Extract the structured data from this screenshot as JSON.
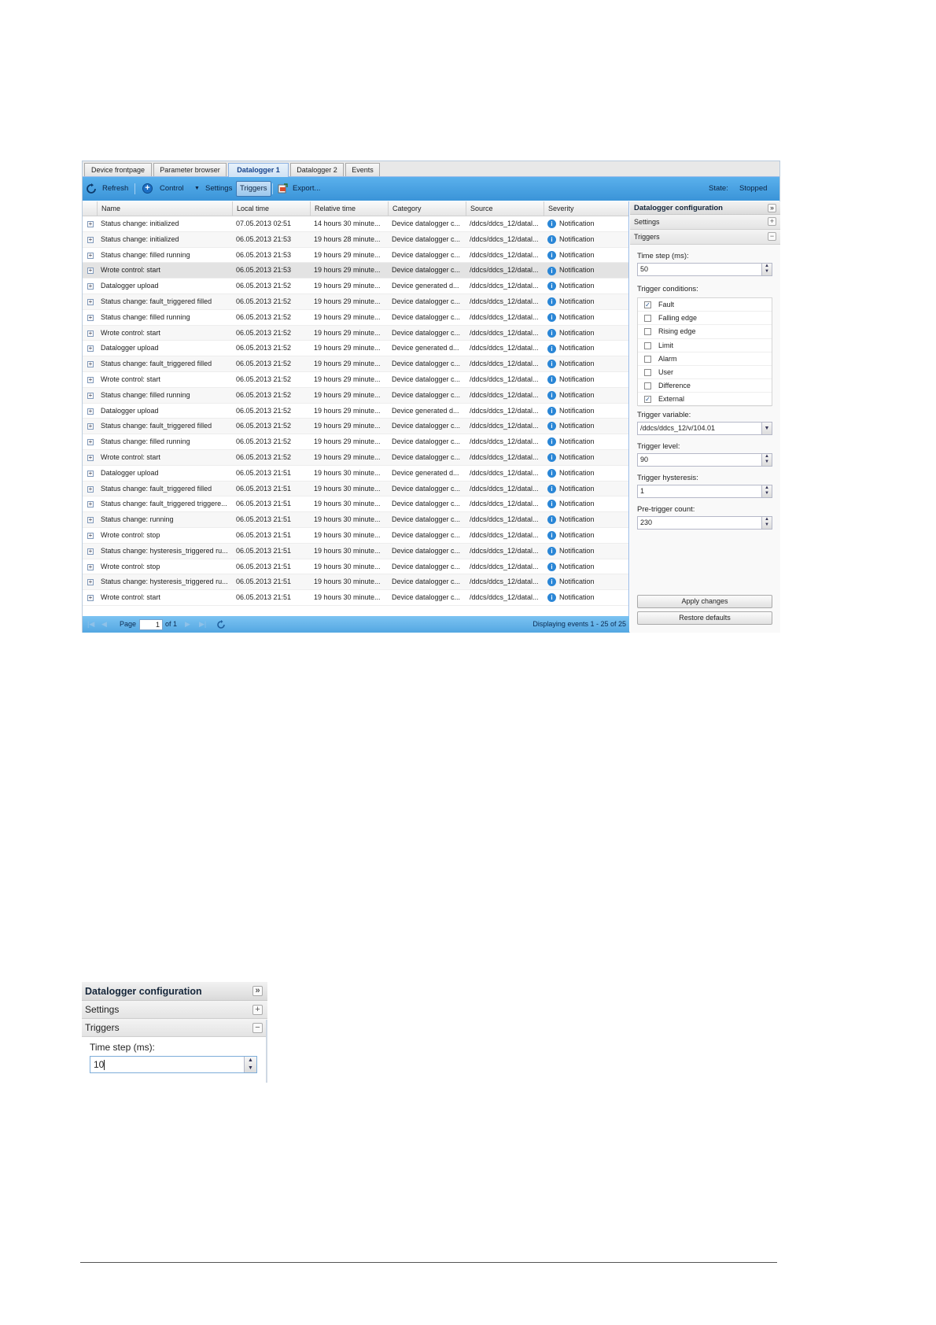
{
  "tabs": [
    {
      "label": "Device frontpage",
      "active": false
    },
    {
      "label": "Parameter browser",
      "active": false
    },
    {
      "label": "Datalogger 1",
      "active": true
    },
    {
      "label": "Datalogger 2",
      "active": false
    },
    {
      "label": "Events",
      "active": false
    }
  ],
  "toolbar": {
    "refresh": "Refresh",
    "control": "Control",
    "settings": "Settings",
    "triggers": "Triggers",
    "export": "Export...",
    "state_label": "State:",
    "state_value": "Stopped",
    "accent_color": "#3a94d8"
  },
  "grid": {
    "columns": [
      "Name",
      "Local time",
      "Relative time",
      "Category",
      "Source",
      "Severity"
    ],
    "rows": [
      [
        "Status change: initialized",
        "07.05.2013 02:51",
        "14 hours 30 minute...",
        "Device datalogger c...",
        "/ddcs/ddcs_12/datal...",
        "Notification"
      ],
      [
        "Status change: initialized",
        "06.05.2013 21:53",
        "19 hours 28 minute...",
        "Device datalogger c...",
        "/ddcs/ddcs_12/datal...",
        "Notification"
      ],
      [
        "Status change: filled running",
        "06.05.2013 21:53",
        "19 hours 29 minute...",
        "Device datalogger c...",
        "/ddcs/ddcs_12/datal...",
        "Notification"
      ],
      [
        "Wrote control: start",
        "06.05.2013 21:53",
        "19 hours 29 minute...",
        "Device datalogger c...",
        "/ddcs/ddcs_12/datal...",
        "Notification"
      ],
      [
        "Datalogger upload",
        "06.05.2013 21:52",
        "19 hours 29 minute...",
        "Device generated d...",
        "/ddcs/ddcs_12/datal...",
        "Notification"
      ],
      [
        "Status change: fault_triggered filled",
        "06.05.2013 21:52",
        "19 hours 29 minute...",
        "Device datalogger c...",
        "/ddcs/ddcs_12/datal...",
        "Notification"
      ],
      [
        "Status change: filled running",
        "06.05.2013 21:52",
        "19 hours 29 minute...",
        "Device datalogger c...",
        "/ddcs/ddcs_12/datal...",
        "Notification"
      ],
      [
        "Wrote control: start",
        "06.05.2013 21:52",
        "19 hours 29 minute...",
        "Device datalogger c...",
        "/ddcs/ddcs_12/datal...",
        "Notification"
      ],
      [
        "Datalogger upload",
        "06.05.2013 21:52",
        "19 hours 29 minute...",
        "Device generated d...",
        "/ddcs/ddcs_12/datal...",
        "Notification"
      ],
      [
        "Status change: fault_triggered filled",
        "06.05.2013 21:52",
        "19 hours 29 minute...",
        "Device datalogger c...",
        "/ddcs/ddcs_12/datal...",
        "Notification"
      ],
      [
        "Wrote control: start",
        "06.05.2013 21:52",
        "19 hours 29 minute...",
        "Device datalogger c...",
        "/ddcs/ddcs_12/datal...",
        "Notification"
      ],
      [
        "Status change: filled running",
        "06.05.2013 21:52",
        "19 hours 29 minute...",
        "Device datalogger c...",
        "/ddcs/ddcs_12/datal...",
        "Notification"
      ],
      [
        "Datalogger upload",
        "06.05.2013 21:52",
        "19 hours 29 minute...",
        "Device generated d...",
        "/ddcs/ddcs_12/datal...",
        "Notification"
      ],
      [
        "Status change: fault_triggered filled",
        "06.05.2013 21:52",
        "19 hours 29 minute...",
        "Device datalogger c...",
        "/ddcs/ddcs_12/datal...",
        "Notification"
      ],
      [
        "Status change: filled running",
        "06.05.2013 21:52",
        "19 hours 29 minute...",
        "Device datalogger c...",
        "/ddcs/ddcs_12/datal...",
        "Notification"
      ],
      [
        "Wrote control: start",
        "06.05.2013 21:52",
        "19 hours 29 minute...",
        "Device datalogger c...",
        "/ddcs/ddcs_12/datal...",
        "Notification"
      ],
      [
        "Datalogger upload",
        "06.05.2013 21:51",
        "19 hours 30 minute...",
        "Device generated d...",
        "/ddcs/ddcs_12/datal...",
        "Notification"
      ],
      [
        "Status change: fault_triggered filled",
        "06.05.2013 21:51",
        "19 hours 30 minute...",
        "Device datalogger c...",
        "/ddcs/ddcs_12/datal...",
        "Notification"
      ],
      [
        "Status change: fault_triggered triggere...",
        "06.05.2013 21:51",
        "19 hours 30 minute...",
        "Device datalogger c...",
        "/ddcs/ddcs_12/datal...",
        "Notification"
      ],
      [
        "Status change: running",
        "06.05.2013 21:51",
        "19 hours 30 minute...",
        "Device datalogger c...",
        "/ddcs/ddcs_12/datal...",
        "Notification"
      ],
      [
        "Wrote control: stop",
        "06.05.2013 21:51",
        "19 hours 30 minute...",
        "Device datalogger c...",
        "/ddcs/ddcs_12/datal...",
        "Notification"
      ],
      [
        "Status change: hysteresis_triggered ru...",
        "06.05.2013 21:51",
        "19 hours 30 minute...",
        "Device datalogger c...",
        "/ddcs/ddcs_12/datal...",
        "Notification"
      ],
      [
        "Wrote control: stop",
        "06.05.2013 21:51",
        "19 hours 30 minute...",
        "Device datalogger c...",
        "/ddcs/ddcs_12/datal...",
        "Notification"
      ],
      [
        "Status change: hysteresis_triggered ru...",
        "06.05.2013 21:51",
        "19 hours 30 minute...",
        "Device datalogger c...",
        "/ddcs/ddcs_12/datal...",
        "Notification"
      ],
      [
        "Wrote control: start",
        "06.05.2013 21:51",
        "19 hours 30 minute...",
        "Device datalogger c...",
        "/ddcs/ddcs_12/datal...",
        "Notification"
      ]
    ],
    "selected_row": 3,
    "severity_icon": "info-icon"
  },
  "pager": {
    "page_label": "Page",
    "page_value": "1",
    "of_label": "of 1",
    "display_text": "Displaying events 1 - 25 of 25"
  },
  "config": {
    "title": "Datalogger configuration",
    "settings_label": "Settings",
    "triggers_label": "Triggers",
    "time_step_label": "Time step (ms):",
    "time_step_value": "50",
    "trigger_conditions_label": "Trigger conditions:",
    "conditions": [
      {
        "label": "Fault",
        "checked": true
      },
      {
        "label": "Falling edge",
        "checked": false
      },
      {
        "label": "Rising edge",
        "checked": false
      },
      {
        "label": "Limit",
        "checked": false
      },
      {
        "label": "Alarm",
        "checked": false
      },
      {
        "label": "User",
        "checked": false
      },
      {
        "label": "Difference",
        "checked": false
      },
      {
        "label": "External",
        "checked": true
      }
    ],
    "trigger_variable_label": "Trigger variable:",
    "trigger_variable_value": "/ddcs/ddcs_12/v/104.01",
    "trigger_level_label": "Trigger level:",
    "trigger_level_value": "90",
    "trigger_hysteresis_label": "Trigger hysteresis:",
    "trigger_hysteresis_value": "1",
    "pretrigger_label": "Pre-trigger count:",
    "pretrigger_value": "230",
    "apply_label": "Apply changes",
    "restore_label": "Restore defaults"
  },
  "zoom": {
    "title": "Datalogger configuration",
    "settings_label": "Settings",
    "triggers_label": "Triggers",
    "time_step_label": "Time step (ms):",
    "time_step_value": "10"
  }
}
